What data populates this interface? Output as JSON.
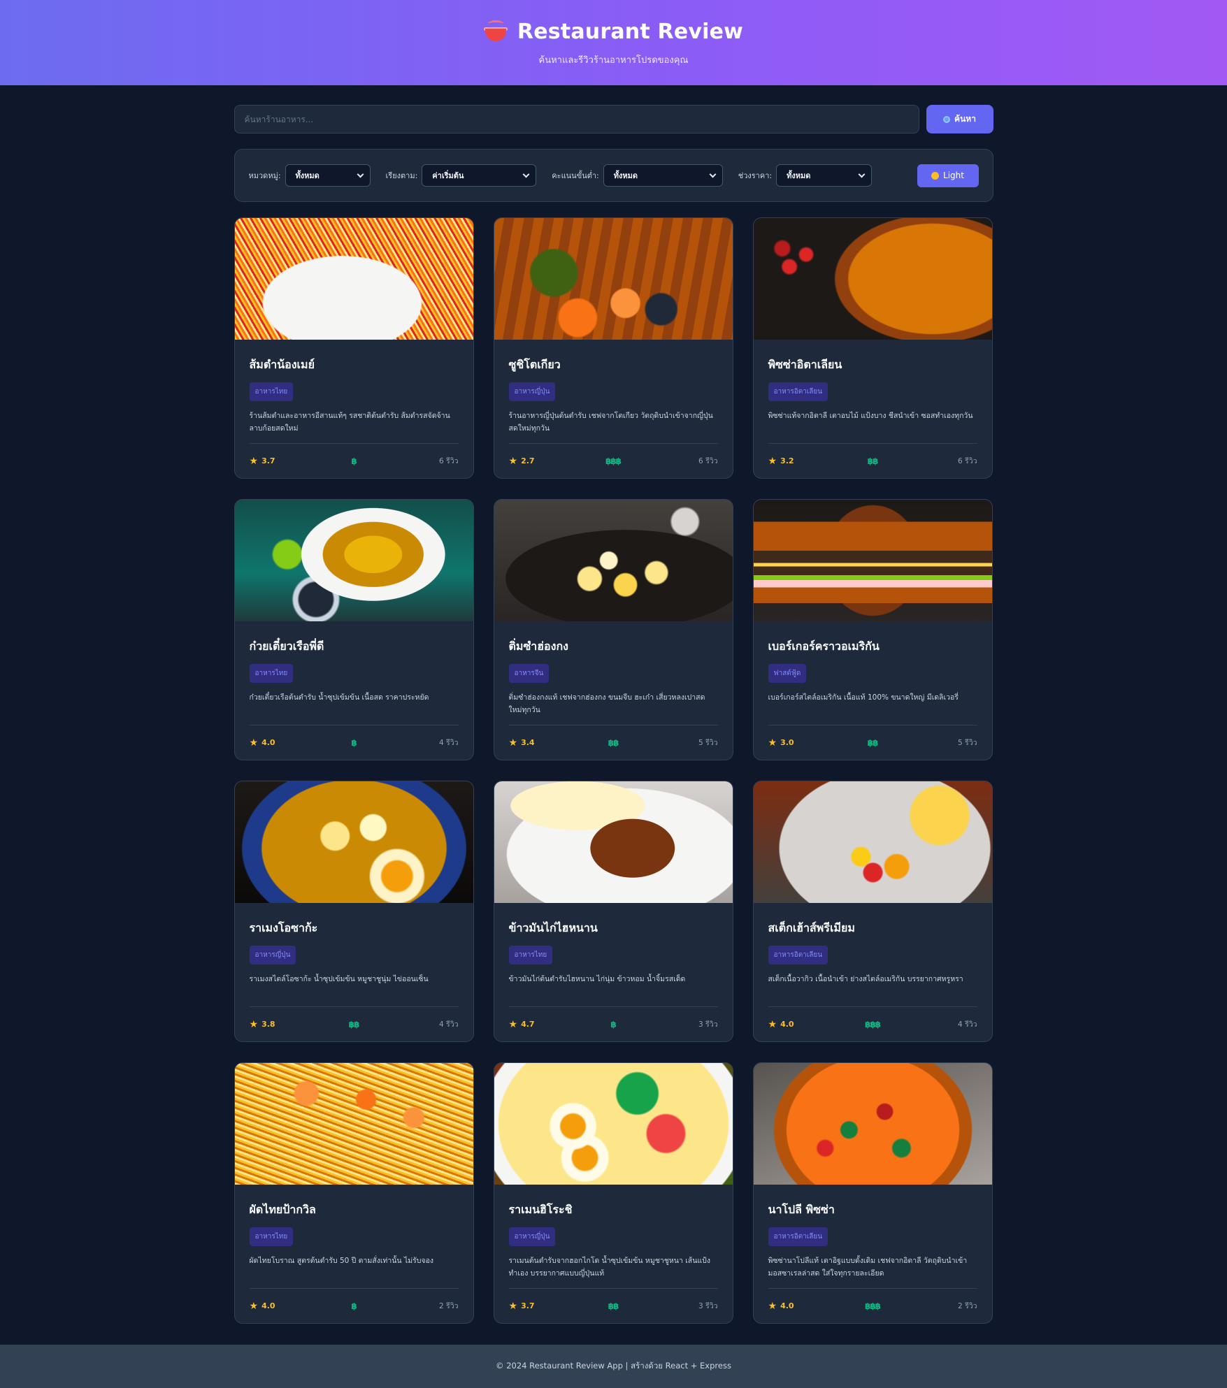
{
  "header": {
    "title": "Restaurant Review",
    "subtitle": "ค้นหาและรีวิวร้านอาหารโปรดของคุณ"
  },
  "search": {
    "placeholder": "ค้นหาร้านอาหาร...",
    "button_label": "ค้นหา"
  },
  "filters": {
    "category_label": "หมวดหมู่:",
    "category_value": "ทั้งหมด",
    "sort_label": "เรียงตาม:",
    "sort_value": "ค่าเริ่มต้น",
    "min_rating_label": "คะแนนขั้นต่ำ:",
    "min_rating_value": "ทั้งหมด",
    "price_label": "ช่วงราคา:",
    "price_value": "ทั้งหมด",
    "theme_button": "Light"
  },
  "restaurants": [
    {
      "name": "ส้มตำน้องเมย์",
      "category": "อาหารไทย",
      "description": "ร้านส้มตำและอาหารอีสานแท้ๆ รสชาติต้นตำรับ ส้มตำรสจัดจ้าน ลาบก้อยสดใหม่",
      "rating": "3.7",
      "price": "฿",
      "reviews": "6 รีวิว"
    },
    {
      "name": "ซูชิโตเกียว",
      "category": "อาหารญี่ปุ่น",
      "description": "ร้านอาหารญี่ปุ่นต้นตำรับ เชฟจากโตเกียว วัตถุดิบนำเข้าจากญี่ปุ่น สดใหม่ทุกวัน",
      "rating": "2.7",
      "price": "฿฿฿",
      "reviews": "6 รีวิว"
    },
    {
      "name": "พิซซ่าอิตาเลียน",
      "category": "อาหารอิตาเลียน",
      "description": "พิซซ่าแท้จากอิตาลี เตาอบไม้ แป้งบาง ชีสนำเข้า ซอสทำเองทุกวัน",
      "rating": "3.2",
      "price": "฿฿",
      "reviews": "6 รีวิว"
    },
    {
      "name": "ก๋วยเตี๋ยวเรือพี่ดี",
      "category": "อาหารไทย",
      "description": "ก๋วยเตี๋ยวเรือต้นตำรับ น้ำซุปเข้มข้น เนื้อสด ราคาประหยัด",
      "rating": "4.0",
      "price": "฿",
      "reviews": "4 รีวิว"
    },
    {
      "name": "ติ่มซำฮ่องกง",
      "category": "อาหารจีน",
      "description": "ติ่มซำฮ่องกงแท้ เชฟจากฮ่องกง ขนมจีบ ฮะเก๋า เสี่ยวหลงเปาสดใหม่ทุกวัน",
      "rating": "3.4",
      "price": "฿฿",
      "reviews": "5 รีวิว"
    },
    {
      "name": "เบอร์เกอร์คราวอเมริกัน",
      "category": "ฟาสต์ฟู้ด",
      "description": "เบอร์เกอร์สไตล์อเมริกัน เนื้อแท้ 100% ขนาดใหญ่ มีเดลิเวอรี่",
      "rating": "3.0",
      "price": "฿฿",
      "reviews": "5 รีวิว"
    },
    {
      "name": "ราเมงโอซาก้ะ",
      "category": "อาหารญี่ปุ่น",
      "description": "ราเมงสไตล์โอซาก้ะ น้ำซุปเข้มข้น หมูชาชูนุ่ม ไข่ออนเซ็น",
      "rating": "3.8",
      "price": "฿฿",
      "reviews": "4 รีวิว"
    },
    {
      "name": "ข้าวมันไก่ไฮหนาน",
      "category": "อาหารไทย",
      "description": "ข้าวมันไก่ต้นตำรับไฮหนาน ไก่นุ่ม ข้าวหอม น้ำจิ้มรสเด็ด",
      "rating": "4.7",
      "price": "฿",
      "reviews": "3 รีวิว"
    },
    {
      "name": "สเต็กเฮ้าส์พรีเมียม",
      "category": "อาหารอิตาเลียน",
      "description": "สเต็กเนื้อวากิว เนื้อนำเข้า ย่างสไตล์อเมริกัน บรรยากาศหรูหรา",
      "rating": "4.0",
      "price": "฿฿฿",
      "reviews": "4 รีวิว"
    },
    {
      "name": "ผัดไทยป้ากวิล",
      "category": "อาหารไทย",
      "description": "ผัดไทยโบราณ สูตรต้นตำรับ 50 ปี ตามสั่งเท่านั้น ไม่รับจอง",
      "rating": "4.0",
      "price": "฿",
      "reviews": "2 รีวิว"
    },
    {
      "name": "ราเมนฮิโระชิ",
      "category": "อาหารญี่ปุ่น",
      "description": "ราเมนต้นตำรับจากฮอกไกโด น้ำซุปเข้มข้น หมูชาชูหนา เส้นแป้งทำเอง บรรยากาศแบบญี่ปุ่นแท้",
      "rating": "3.7",
      "price": "฿฿",
      "reviews": "3 รีวิว"
    },
    {
      "name": "นาโปลี พิซซ่า",
      "category": "อาหารอิตาเลียน",
      "description": "พิซซ่านาโปลีแท้ เตาอิฐแบบดั้งเดิม เชฟจากอิตาลี วัตถุดิบนำเข้า มอสซาเรลล่าสด ใส่ใจทุกรายละเอียด",
      "rating": "4.0",
      "price": "฿฿฿",
      "reviews": "2 รีวิว"
    }
  ],
  "footer": {
    "text": "© 2024 Restaurant Review App | สร้างด้วย React + Express"
  }
}
